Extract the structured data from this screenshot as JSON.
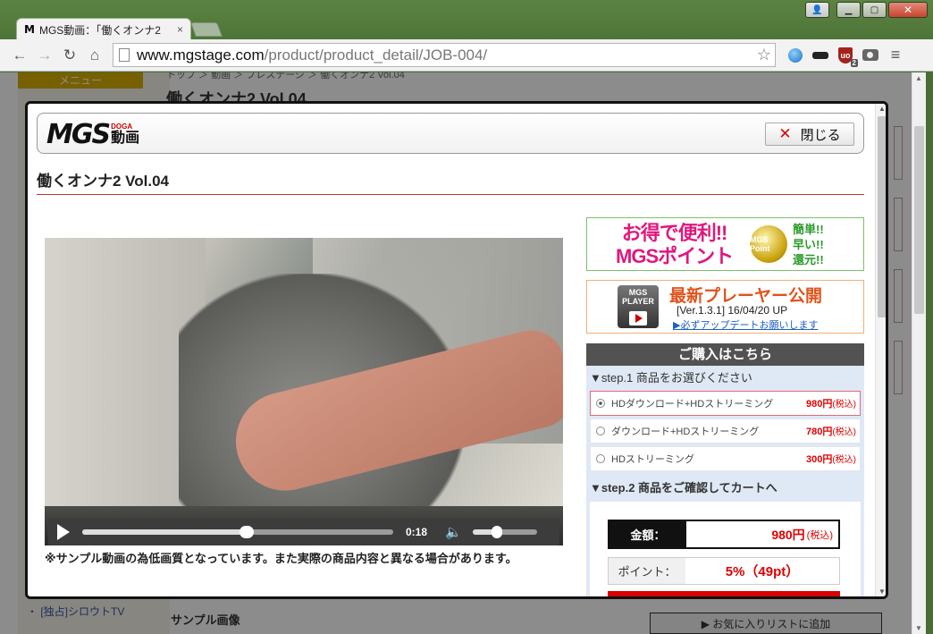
{
  "browser": {
    "tab_favicon": "M",
    "tab_title": "MGS動画：「働くオンナ2",
    "tab_close": "×",
    "url_host": "www.mgstage.com",
    "url_path": "/product/product_detail/JOB-004/",
    "ublock_badge": "2",
    "ublock_label": "uo"
  },
  "background_page": {
    "menu_tab": "メニュー",
    "breadcrumb": "トップ ＞ 動画 ＞ プレステージ ＞ 働くオンナ2 Vol.04",
    "heading": "働くオンナ2 Vol.04",
    "left_link": "・ [独占]シロウトTV",
    "sample_heading": "サンプル画像",
    "favorite_button": "▶ お気に入りリストに追加"
  },
  "modal": {
    "logo_text": "MGS",
    "logo_sub": "DOGA",
    "logo_douga": "動画",
    "close_label": "閉じる",
    "close_icon": "✕",
    "product_title": "働くオンナ2 Vol.04",
    "video": {
      "time": "0:18",
      "progress": 0.53,
      "volume": 0.38
    },
    "sample_note": "※サンプル動画の為低画質となっています。また実際の商品内容と異なる場合があります。",
    "banner_points": {
      "main_line1": "お得で便利!!",
      "main_line2": "MGSポイント",
      "coin": "MGS Point",
      "side_line1": "簡単!!",
      "side_line2": "早い!!",
      "side_line3": "還元!!"
    },
    "banner_player": {
      "icon_label": "MGS PLAYER",
      "main": "最新プレーヤー公開",
      "version": "[Ver.1.3.1]  16/04/20 UP",
      "link": "▶必ずアップデートお願いします"
    },
    "purchase": {
      "header": "ご購入はこちら",
      "step1": "▼step.1 商品をお選びください",
      "options": [
        {
          "label": "HDダウンロード+HDストリーミング",
          "price": "980円",
          "tax": "(税込)",
          "selected": true
        },
        {
          "label": "ダウンロード+HDストリーミング",
          "price": "780円",
          "tax": "(税込)",
          "selected": false
        },
        {
          "label": "HDストリーミング",
          "price": "300円",
          "tax": "(税込)",
          "selected": false
        }
      ],
      "step2": "▼step.2 商品をご確認してカートへ",
      "amount_label": "金額：",
      "amount_value": "980円",
      "amount_tax": "(税込)",
      "point_label": "ポイント：",
      "point_value": "5%（49pt）"
    }
  }
}
